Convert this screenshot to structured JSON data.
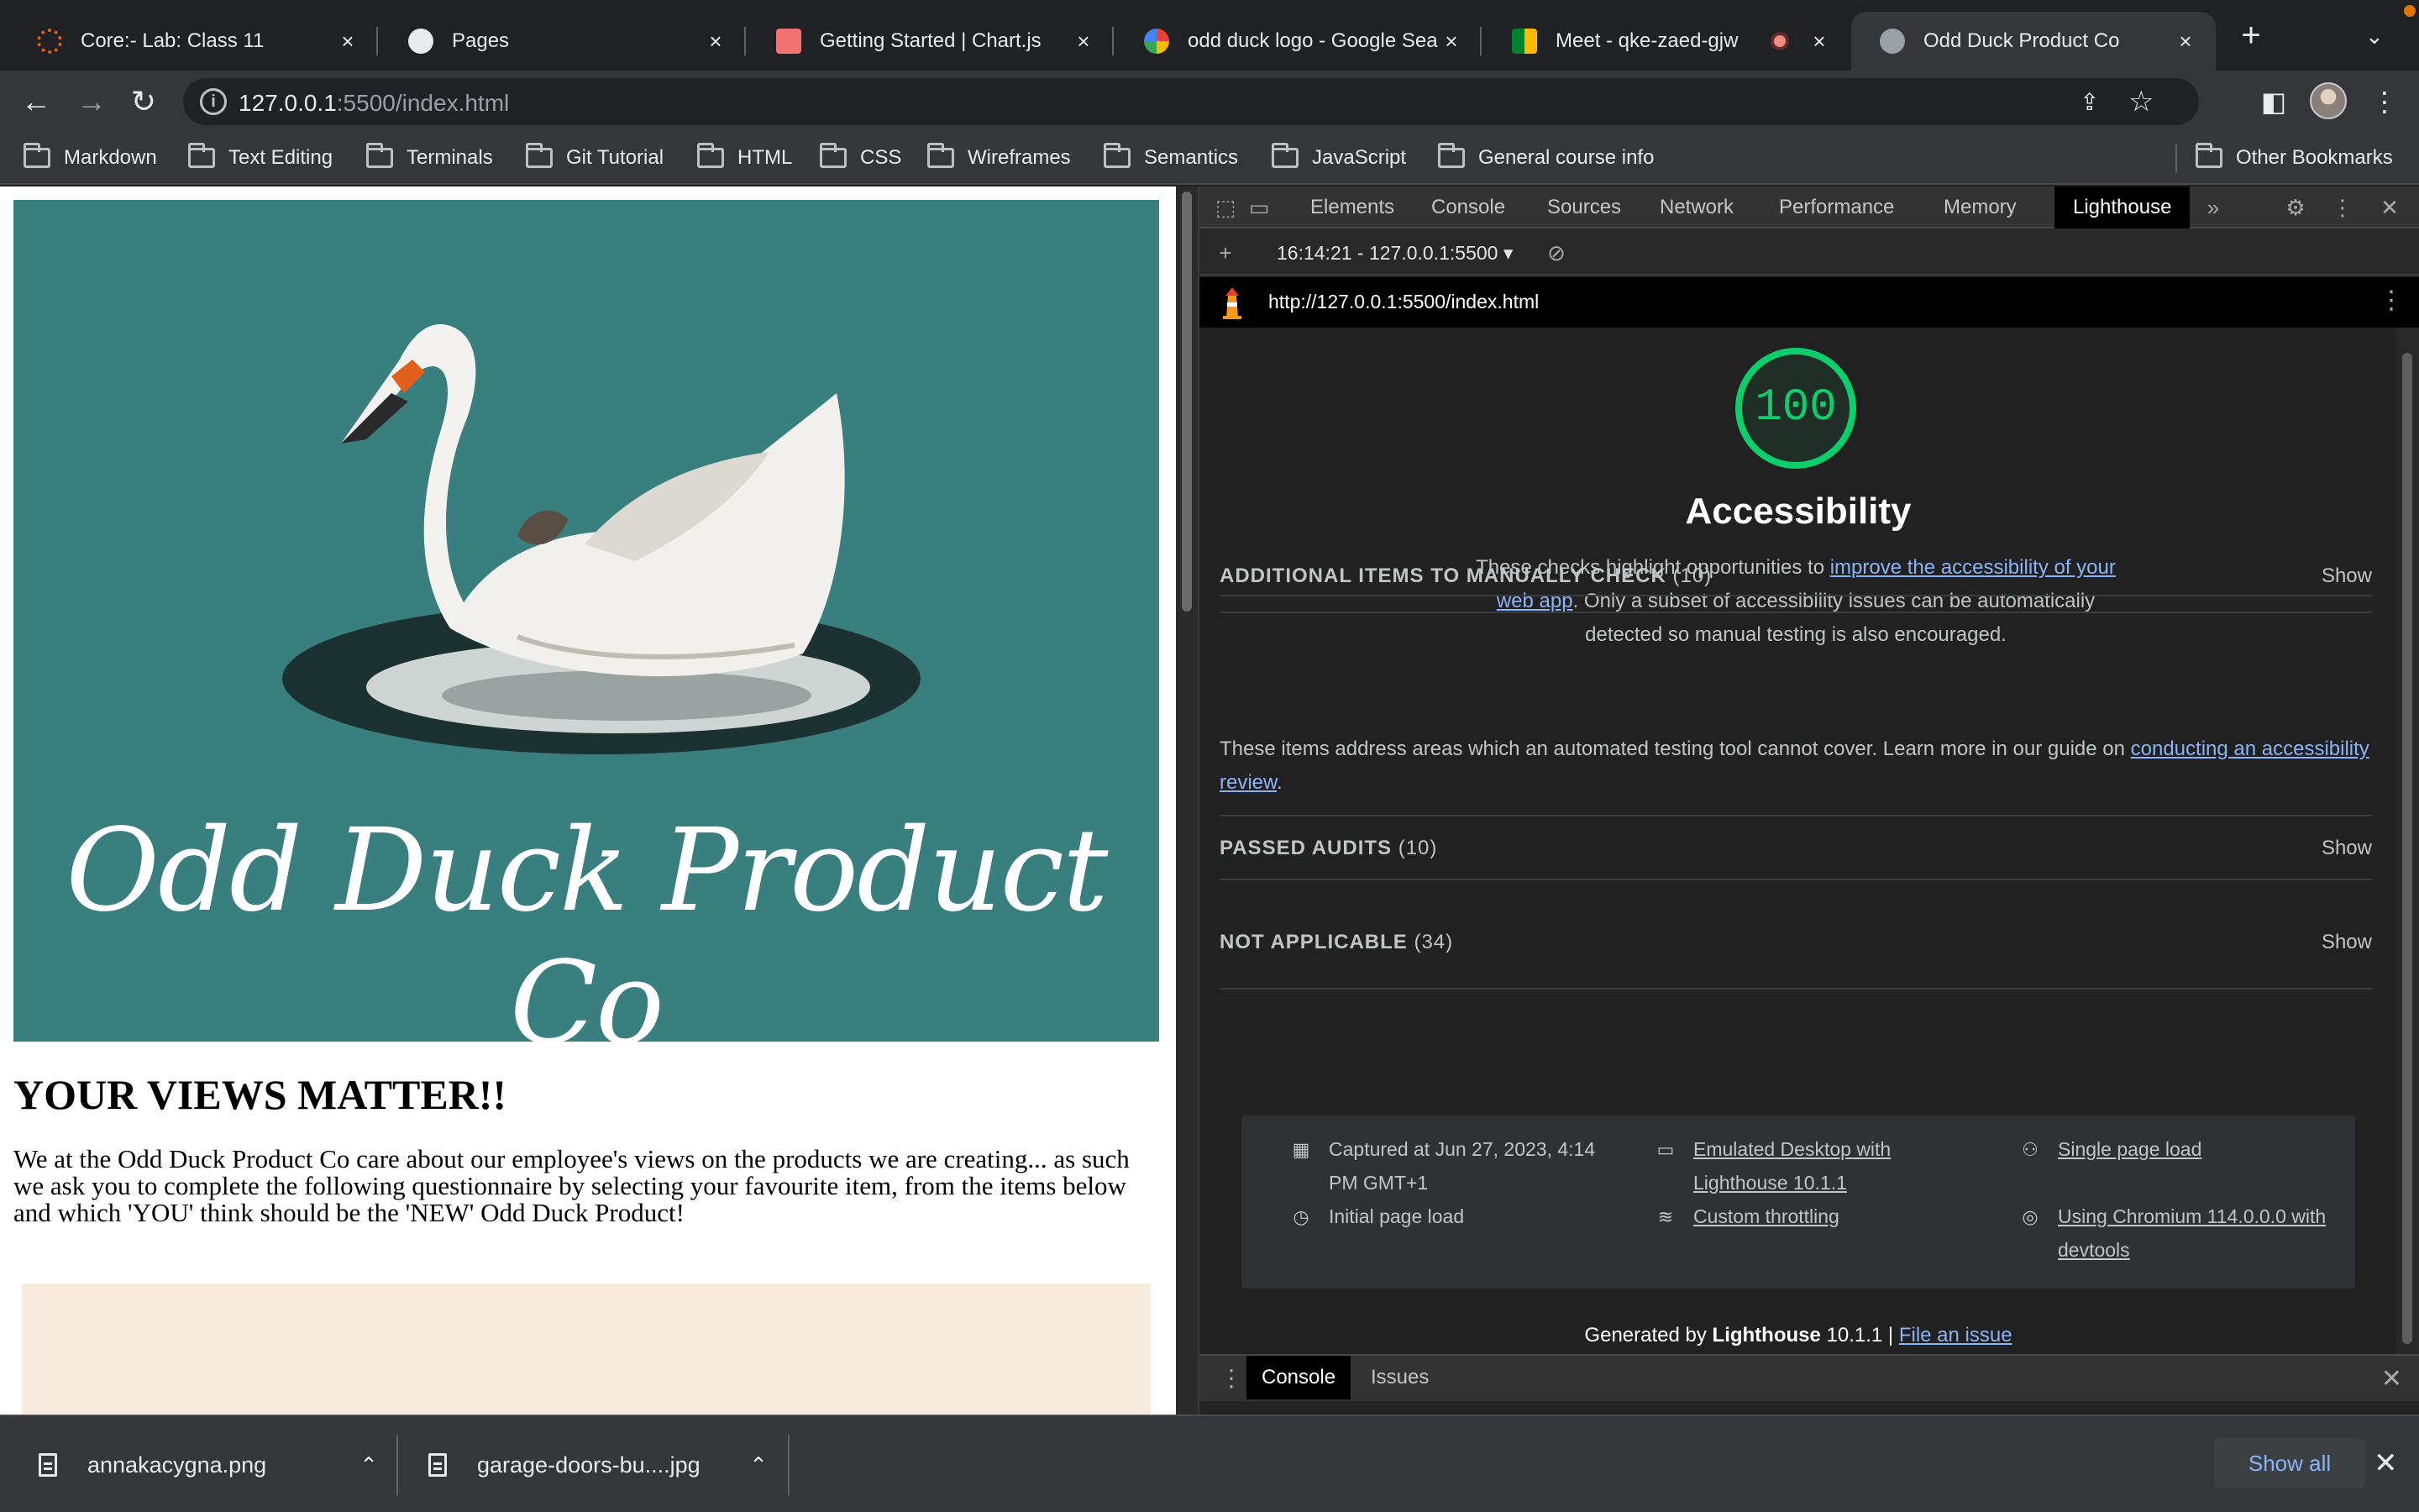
{
  "browser": {
    "tabs": [
      {
        "title": "Core:- Lab: Class 11",
        "icon": "canvas-icon"
      },
      {
        "title": "Pages",
        "icon": "github-icon"
      },
      {
        "title": "Getting Started | Chart.js",
        "icon": "chartjs-icon"
      },
      {
        "title": "odd duck logo - Google Sea",
        "icon": "google-icon"
      },
      {
        "title": "Meet - qke-zaed-gjw",
        "icon": "meet-icon"
      },
      {
        "title": "Odd Duck Product Co",
        "icon": "globe-icon",
        "active": true
      }
    ],
    "url": {
      "host": "127.0.0.1",
      "rest": ":5500/index.html"
    },
    "bookmarks": [
      "Markdown",
      "Text Editing",
      "Terminals",
      "Git Tutorial",
      "HTML",
      "CSS",
      "Wireframes",
      "Semantics",
      "JavaScript",
      "General course info"
    ],
    "other_bookmarks": "Other Bookmarks"
  },
  "webpage": {
    "hero_title": "Odd Duck Product Co",
    "heading": "YOUR VIEWS MATTER!!",
    "paragraph": "We at the Odd Duck Product Co care about our employee's views on the products we are creating... as such we ask you to complete the following questionnaire by selecting your favourite item, from the items below and which 'YOU' think should be the 'NEW' Odd Duck Product!",
    "colors": {
      "hero_bg": "#3a7f7f",
      "survey_bg": "#f7ebdb"
    }
  },
  "devtools": {
    "tabs": [
      "Elements",
      "Console",
      "Sources",
      "Network",
      "Performance",
      "Memory",
      "Lighthouse"
    ],
    "active_tab": "Lighthouse",
    "report_select": "16:14:21 - 127.0.0.1:5500",
    "report_url": "http://127.0.0.1:5500/index.html",
    "score": "100",
    "category": "Accessibility",
    "desc_before": "These checks highlight opportunities to ",
    "desc_link": "improve the accessibility of your web app",
    "desc_after": ". Only a subset of accessibility issues can be automatically detected so manual testing is also encouraged.",
    "groups": [
      {
        "title": "ADDITIONAL ITEMS TO MANUALLY CHECK",
        "count": "(10)",
        "action": "Show"
      },
      {
        "title": "PASSED AUDITS",
        "count": "(10)",
        "action": "Show"
      },
      {
        "title": "NOT APPLICABLE",
        "count": "(34)",
        "action": "Show"
      }
    ],
    "manual_desc_before": "These items address areas which an automated testing tool cannot cover. Learn more in our guide on ",
    "manual_desc_link": "conducting an accessibility review",
    "manual_desc_after": ".",
    "env": {
      "captured": "Captured at Jun 27, 2023, 4:14 PM GMT+1",
      "initial": "Initial page load",
      "emulated": "Emulated Desktop with Lighthouse 10.1.1",
      "throttling": "Custom throttling",
      "single": "Single page load",
      "chromium": "Using Chromium 114.0.0.0 with devtools"
    },
    "generated_prefix": "Generated by ",
    "generated_brand": "Lighthouse",
    "generated_version": " 10.1.1 | ",
    "file_issue": "File an issue",
    "drawer_tabs": [
      "Console",
      "Issues"
    ],
    "score_color": "#0cce6b"
  },
  "downloads": {
    "items": [
      "annakacygna.png",
      "garage-doors-bu....jpg"
    ],
    "show_all": "Show all"
  }
}
